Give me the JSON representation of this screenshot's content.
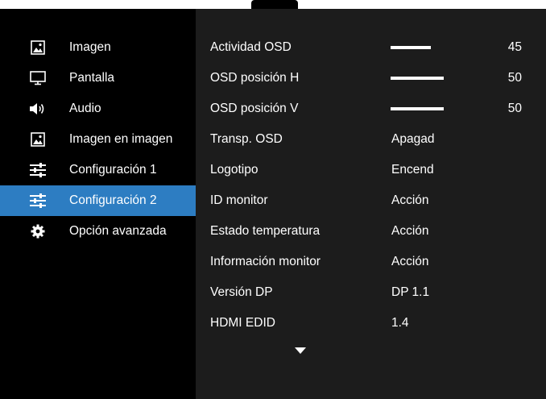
{
  "sidebar": {
    "items": [
      {
        "label": "Imagen",
        "icon": "image-icon",
        "active": false
      },
      {
        "label": "Pantalla",
        "icon": "monitor-icon",
        "active": false
      },
      {
        "label": "Audio",
        "icon": "speaker-icon",
        "active": false
      },
      {
        "label": "Imagen en imagen",
        "icon": "pip-image-icon",
        "active": false
      },
      {
        "label": "Configuración 1",
        "icon": "sliders-icon",
        "active": false
      },
      {
        "label": "Configuración 2",
        "icon": "sliders-icon",
        "active": true
      },
      {
        "label": "Opción avanzada",
        "icon": "gear-icon",
        "active": false
      }
    ]
  },
  "settings": {
    "rows": [
      {
        "label": "Actividad OSD",
        "type": "slider",
        "value": "45",
        "level": 0.45
      },
      {
        "label": "OSD posición H",
        "type": "slider",
        "value": "50",
        "level": 0.5
      },
      {
        "label": "OSD posición V",
        "type": "slider",
        "value": "50",
        "level": 0.5
      },
      {
        "label": "Transp. OSD",
        "type": "text",
        "value": "Apagad"
      },
      {
        "label": "Logotipo",
        "type": "text",
        "value": "Encend"
      },
      {
        "label": "ID monitor",
        "type": "text",
        "value": "Acción"
      },
      {
        "label": "Estado temperatura",
        "type": "text",
        "value": "Acción"
      },
      {
        "label": "Información monitor",
        "type": "text",
        "value": "Acción"
      },
      {
        "label": "Versión DP",
        "type": "text",
        "value": "DP 1.1"
      },
      {
        "label": "HDMI EDID",
        "type": "text",
        "value": "1.4"
      }
    ],
    "scroll_indicator": "chevron-down-icon"
  },
  "colors": {
    "active_highlight": "#2d7dc2",
    "sidebar_bg": "#000000",
    "panel_bg": "#1c1c1c",
    "text": "#ffffff"
  }
}
